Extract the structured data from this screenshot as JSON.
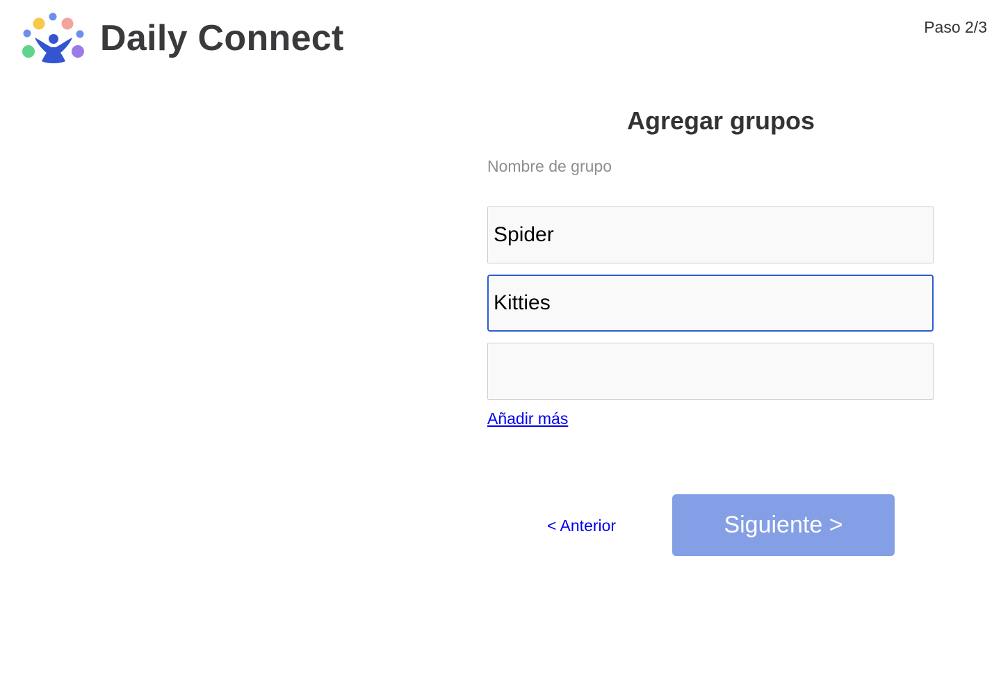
{
  "brand": {
    "name": "Daily Connect",
    "colors": {
      "yellow": "#f7c948",
      "pink": "#f2a39c",
      "blue": "#6b8ef0",
      "green": "#5fd38a",
      "purple": "#9b7be8",
      "figure": "#3355d1"
    }
  },
  "header": {
    "step": "Paso 2/3"
  },
  "form": {
    "title": "Agregar grupos",
    "label": "Nombre de grupo",
    "inputs": [
      {
        "value": "Spider",
        "focused": false
      },
      {
        "value": "Kitties",
        "focused": true
      },
      {
        "value": "",
        "focused": false
      }
    ],
    "add_more": "Añadir más"
  },
  "nav": {
    "previous": "< Anterior",
    "next": "Siguiente >",
    "next_color": "#849fe6"
  }
}
